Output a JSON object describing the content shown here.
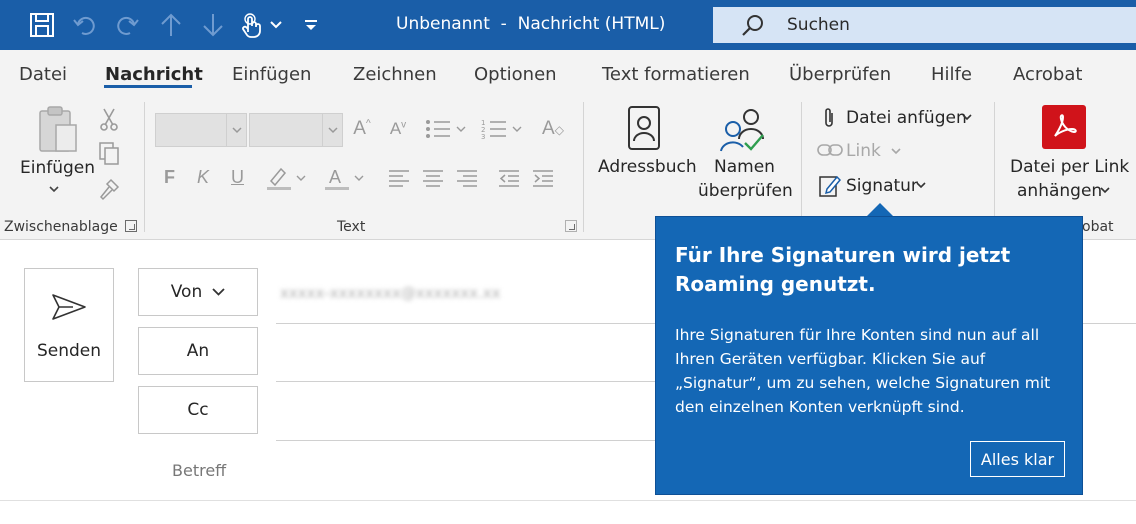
{
  "window": {
    "title": "Unbenannt  -  Nachricht (HTML)"
  },
  "search": {
    "placeholder": "Suchen"
  },
  "tabs": [
    {
      "label": "Datei"
    },
    {
      "label": "Nachricht",
      "active": true
    },
    {
      "label": "Einfügen"
    },
    {
      "label": "Zeichnen"
    },
    {
      "label": "Optionen"
    },
    {
      "label": "Text formatieren"
    },
    {
      "label": "Überprüfen"
    },
    {
      "label": "Hilfe"
    },
    {
      "label": "Acrobat"
    }
  ],
  "ribbon": {
    "clipboard": {
      "paste_label": "Einfügen",
      "group_label": "Zwischenablage"
    },
    "text": {
      "group_label": "Text",
      "bold": "F",
      "italic": "K",
      "underline": "U"
    },
    "names": {
      "address_book": "Adressbuch",
      "check_names_1": "Namen",
      "check_names_2": "überprüfen"
    },
    "include": {
      "attach_file": "Datei anfügen",
      "link": "Link",
      "signature": "Signatur"
    },
    "acrobat": {
      "line1": "Datei per Link",
      "line2": "anhängen",
      "group_label_partial": "obat"
    }
  },
  "compose": {
    "send_label": "Senden",
    "from_label": "Von",
    "to_label": "An",
    "cc_label": "Cc",
    "subject_label": "Betreff"
  },
  "callout": {
    "title": "Für Ihre Signaturen wird jetzt Roaming genutzt.",
    "body": "Ihre Signaturen für Ihre Konten sind nun auf all Ihren Geräten verfügbar. Klicken Sie auf „Signatur“, um zu sehen, welche Signaturen mit den einzelnen Konten verknüpft sind.",
    "button": "Alles klar"
  },
  "colors": {
    "titlebar": "#1a5ea8",
    "callout": "#1467b5",
    "pdf_red": "#d0131a"
  }
}
